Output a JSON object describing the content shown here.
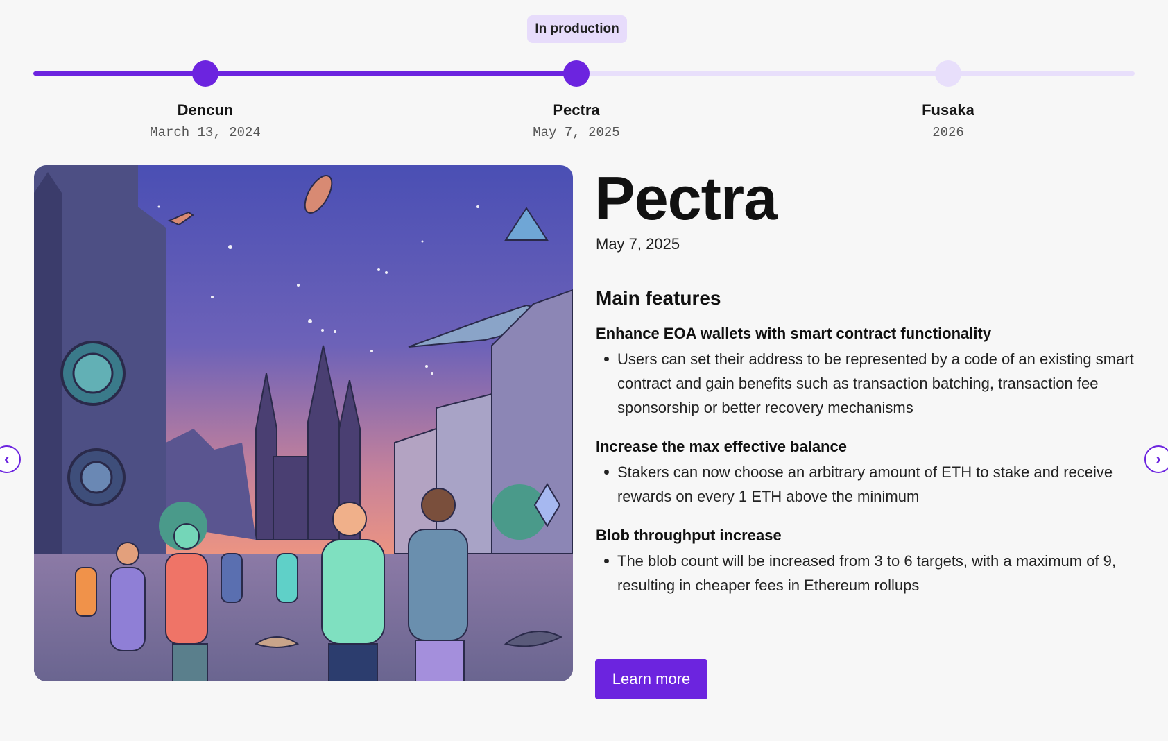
{
  "status_badge": "In production",
  "timeline": [
    {
      "name": "Dencun",
      "date": "March 13, 2024",
      "state": "active"
    },
    {
      "name": "Pectra",
      "date": "May 7, 2025",
      "state": "active"
    },
    {
      "name": "Fusaka",
      "date": "2026",
      "state": "pending"
    }
  ],
  "release": {
    "title": "Pectra",
    "date": "May 7, 2025",
    "features_heading": "Main features",
    "features": [
      {
        "title": "Enhance EOA wallets with smart contract functionality",
        "bullet": "Users can set their address to be represented by a code of an existing smart contract and gain benefits such as transaction batching, transaction fee sponsorship or better recovery mechanisms"
      },
      {
        "title": "Increase the max effective balance",
        "bullet": "Stakers can now choose an arbitrary amount of ETH to stake and receive rewards on every 1 ETH above the minimum"
      },
      {
        "title": "Blob throughput increase",
        "bullet": "The blob count will be increased from 3 to 6 targets, with a maximum of 9, resulting in cheaper fees in Ethereum rollups"
      }
    ],
    "cta": "Learn more"
  },
  "nav": {
    "prev_icon": "chevron-left-icon",
    "next_icon": "chevron-right-icon"
  },
  "colors": {
    "accent": "#6c24df",
    "accent_light": "#e8dffb",
    "badge_bg": "#e7dcfb",
    "background": "#f7f7f7"
  }
}
